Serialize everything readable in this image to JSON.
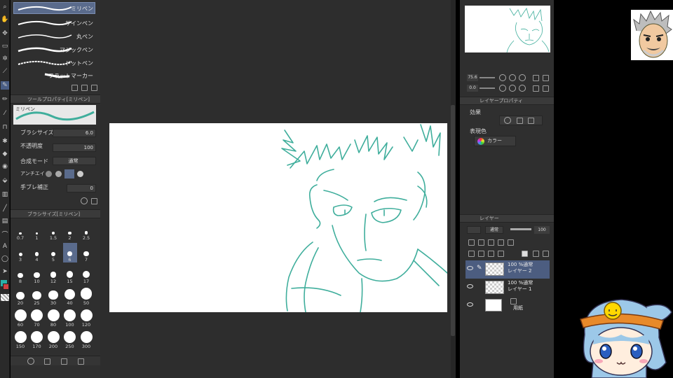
{
  "brushes": [
    {
      "label": "ミリペン",
      "selected": true
    },
    {
      "label": "サインペン",
      "selected": false
    },
    {
      "label": "丸ペン",
      "selected": false
    },
    {
      "label": "マジックペン",
      "selected": false
    },
    {
      "label": "ドットペン",
      "selected": false
    },
    {
      "label": "フラットマーカー",
      "selected": false
    }
  ],
  "tool_property": {
    "header": "ツールプロパティ[ミリペン]",
    "preview_label": "ミリペン",
    "brush_size_label": "ブラシサイズ",
    "brush_size_value": "6.0",
    "opacity_label": "不透明度",
    "opacity_value": "100",
    "blend_label": "合成モード",
    "blend_value": "通常",
    "antialias_label": "アンチエイ",
    "stabilization_label": "手ブレ補正",
    "stabilization_value": "0"
  },
  "brush_size_panel": {
    "header": "ブラシサイズ[ミリペン]",
    "sizes": [
      "0.7",
      "1",
      "1.5",
      "2",
      "2.5",
      "3",
      "4",
      "5",
      "6",
      "7",
      "8",
      "10",
      "12",
      "15",
      "17",
      "20",
      "25",
      "30",
      "40",
      "50",
      "60",
      "70",
      "80",
      "100",
      "120",
      "150",
      "170",
      "200",
      "250",
      "300"
    ],
    "selected": "6"
  },
  "navigator": {
    "zoom": "75.6",
    "rotate": "0.0"
  },
  "layer_property": {
    "header": "レイヤープロパティ",
    "effect_label": "効果",
    "color_label": "表現色",
    "color_value": "カラー"
  },
  "layers_panel": {
    "header": "レイヤー",
    "blend": "通常",
    "opacity": "100",
    "layers": [
      {
        "meta": "100 %通常",
        "name": "レイヤー 2",
        "selected": true
      },
      {
        "meta": "100 %通常",
        "name": "レイヤー 1",
        "selected": false
      },
      {
        "meta": "",
        "name": "用紙",
        "selected": false
      }
    ]
  },
  "colors": {
    "line": "#3fae9c",
    "selection": "#5a6b8c",
    "panel": "#2f2f2f"
  }
}
